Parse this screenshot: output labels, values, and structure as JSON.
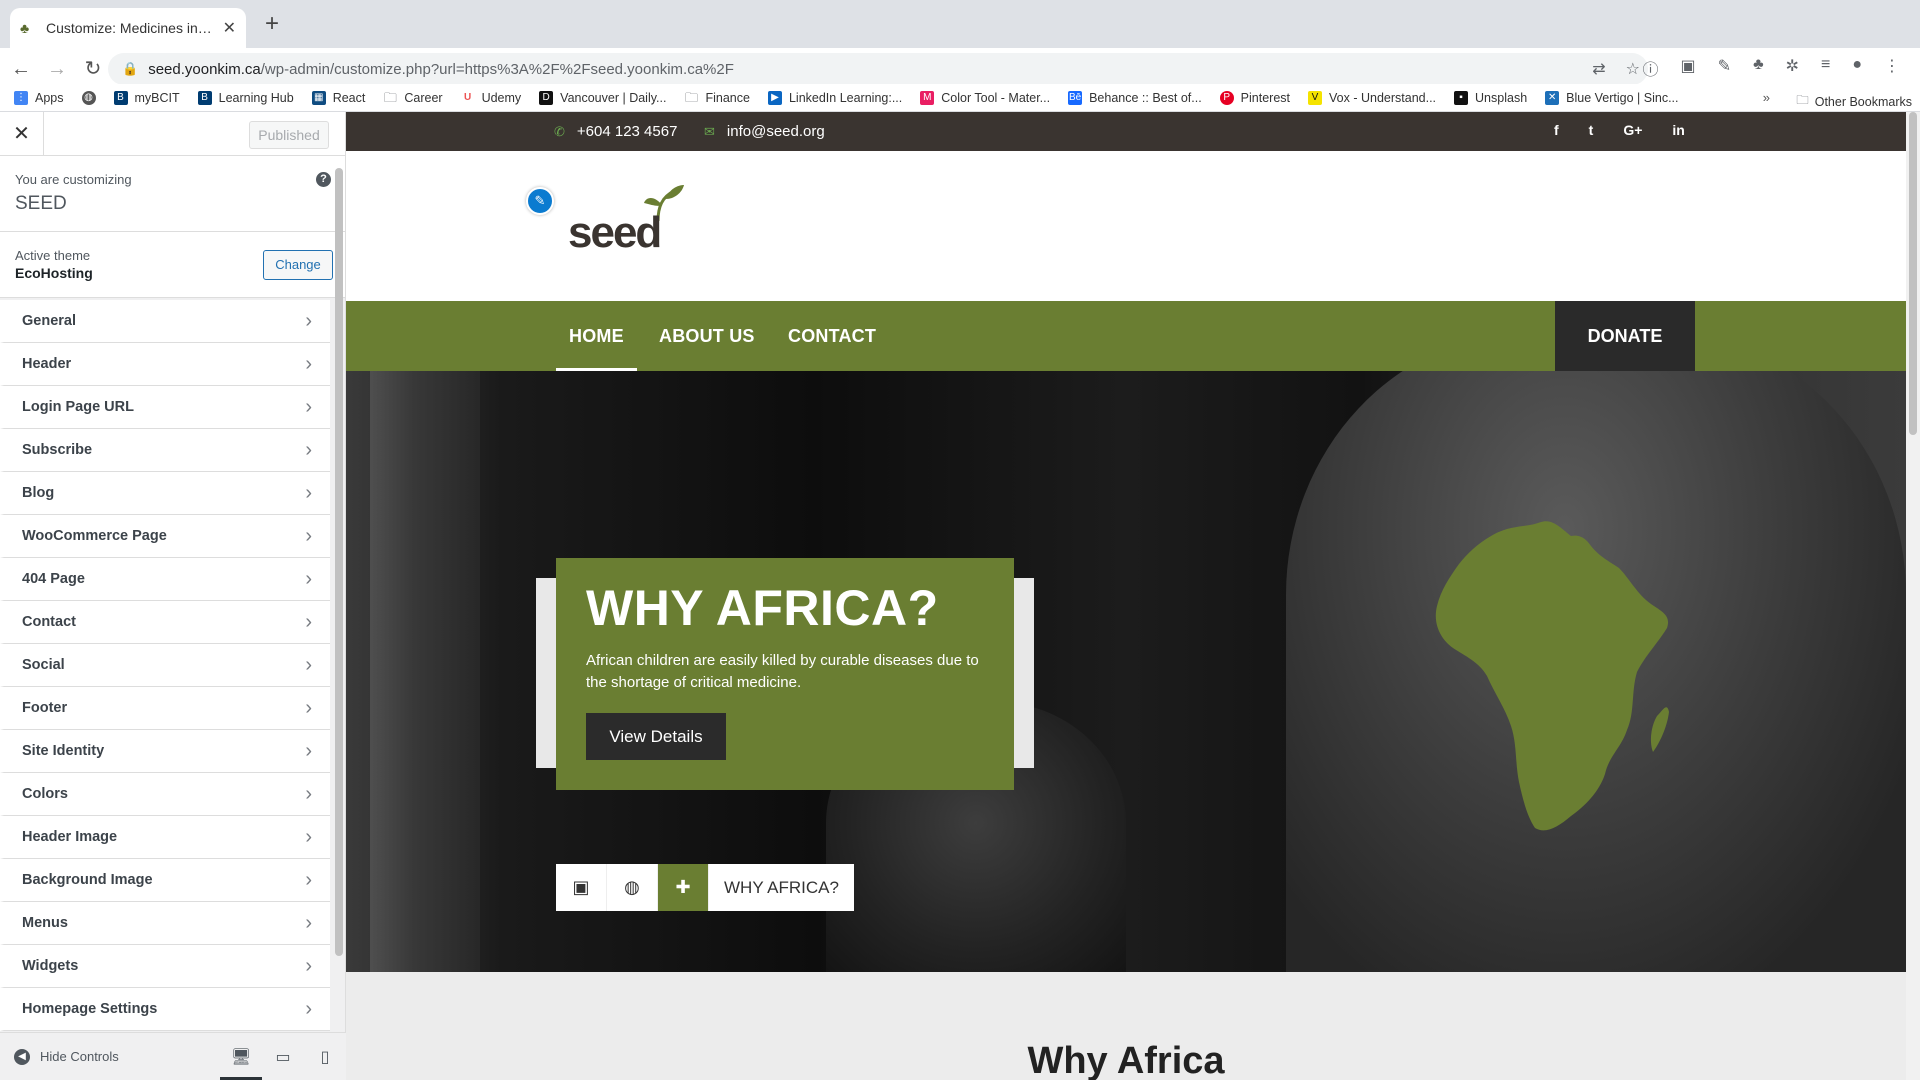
{
  "browser": {
    "tab_title": "Customize: Medicines in Africa",
    "url_host": "seed.yoonkim.ca",
    "url_path": "/wp-admin/customize.php?url=https%3A%2F%2Fseed.yoonkim.ca%2F",
    "bookmarks": [
      {
        "label": "Apps",
        "icon": "apps-grid-icon",
        "color": "#4285f4"
      },
      {
        "label": "",
        "icon": "globe-icon",
        "color": "#555555"
      },
      {
        "label": "myBCIT",
        "icon": "bcit-icon",
        "color": "#003c71"
      },
      {
        "label": "Learning Hub",
        "icon": "bcit-icon",
        "color": "#003c71"
      },
      {
        "label": "React",
        "icon": "bookmark-icon",
        "color": "#0f4c81"
      },
      {
        "label": "Career",
        "icon": "folder-icon",
        "color": "#5f6368"
      },
      {
        "label": "Udemy",
        "icon": "udemy-icon",
        "color": "#ec5252"
      },
      {
        "label": "Vancouver | Daily...",
        "icon": "dh-icon",
        "color": "#111111"
      },
      {
        "label": "Finance",
        "icon": "folder-icon",
        "color": "#5f6368"
      },
      {
        "label": "LinkedIn Learning:...",
        "icon": "linkedin-icon",
        "color": "#0a66c2"
      },
      {
        "label": "Color Tool - Mater...",
        "icon": "material-icon",
        "color": "#e91e63"
      },
      {
        "label": "Behance :: Best of...",
        "icon": "behance-icon",
        "color": "#1769ff"
      },
      {
        "label": "Pinterest",
        "icon": "pinterest-icon",
        "color": "#e60023"
      },
      {
        "label": "Vox - Understand...",
        "icon": "vox-icon",
        "color": "#f5e300"
      },
      {
        "label": "Unsplash",
        "icon": "unsplash-icon",
        "color": "#111111"
      },
      {
        "label": "Blue Vertigo | Sinc...",
        "icon": "bluevertigo-icon",
        "color": "#1d6fb8"
      }
    ],
    "more_label": "»",
    "other_bookmarks": "Other Bookmarks"
  },
  "sidebar": {
    "published_label": "Published",
    "customizing_label": "You are customizing",
    "site_name": "SEED",
    "active_theme_label": "Active theme",
    "theme_name": "EcoHosting",
    "change_label": "Change",
    "items": [
      {
        "label": "General"
      },
      {
        "label": "Header"
      },
      {
        "label": "Login Page URL"
      },
      {
        "label": "Subscribe"
      },
      {
        "label": "Blog"
      },
      {
        "label": "WooCommerce Page"
      },
      {
        "label": "404 Page"
      },
      {
        "label": "Contact"
      },
      {
        "label": "Social"
      },
      {
        "label": "Footer"
      },
      {
        "label": "Site Identity"
      },
      {
        "label": "Colors"
      },
      {
        "label": "Header Image"
      },
      {
        "label": "Background Image"
      },
      {
        "label": "Menus"
      },
      {
        "label": "Widgets"
      },
      {
        "label": "Homepage Settings"
      }
    ],
    "hide_controls_label": "Hide Controls"
  },
  "site": {
    "phone": "+604 123 4567",
    "email": "info@seed.org",
    "socials": [
      "f",
      "t",
      "G+",
      "in"
    ],
    "nav": [
      {
        "label": "HOME",
        "active": true
      },
      {
        "label": "ABOUT US",
        "active": false
      },
      {
        "label": "CONTACT",
        "active": false
      }
    ],
    "donate_label": "DONATE",
    "hero": {
      "title": "WHY AFRICA?",
      "text": "African children are easily killed by curable diseases due to the shortage of critical medicine.",
      "button": "View Details",
      "tab_label": "WHY AFRICA?"
    },
    "section_title": "Why Africa"
  },
  "colors": {
    "brand_green": "#6a7e32",
    "topbar_dark": "#3a3430",
    "wp_blue": "#2271b1"
  }
}
